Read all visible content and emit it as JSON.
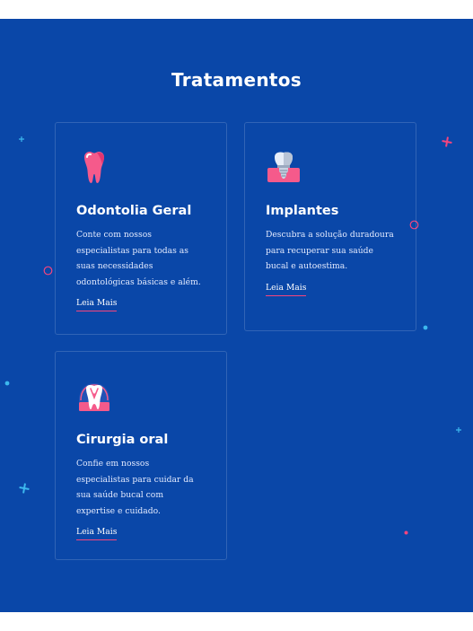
{
  "section": {
    "title": "Tratamentos"
  },
  "cards": [
    {
      "title": "Odontolia Geral",
      "text": "Conte com nossos especialistas para todas as suas necessidades odontológicas básicas e além.",
      "link": "Leia Mais",
      "icon": "tooth-icon"
    },
    {
      "title": "Implantes",
      "text": "Descubra a solução duradoura para recuperar sua saúde bucal e autoestima.",
      "link": "Leia Mais",
      "icon": "dental-implant-icon"
    },
    {
      "title": "Cirurgia oral",
      "text": "Confie em nossos especialistas para cuidar da sua saúde bucal com expertise e cuidado.",
      "link": "Leia Mais",
      "icon": "tooth-surgery-icon"
    }
  ],
  "colors": {
    "background": "#0a47a8",
    "accent_pink": "#f5457e",
    "accent_blue": "#3cb8ee"
  }
}
